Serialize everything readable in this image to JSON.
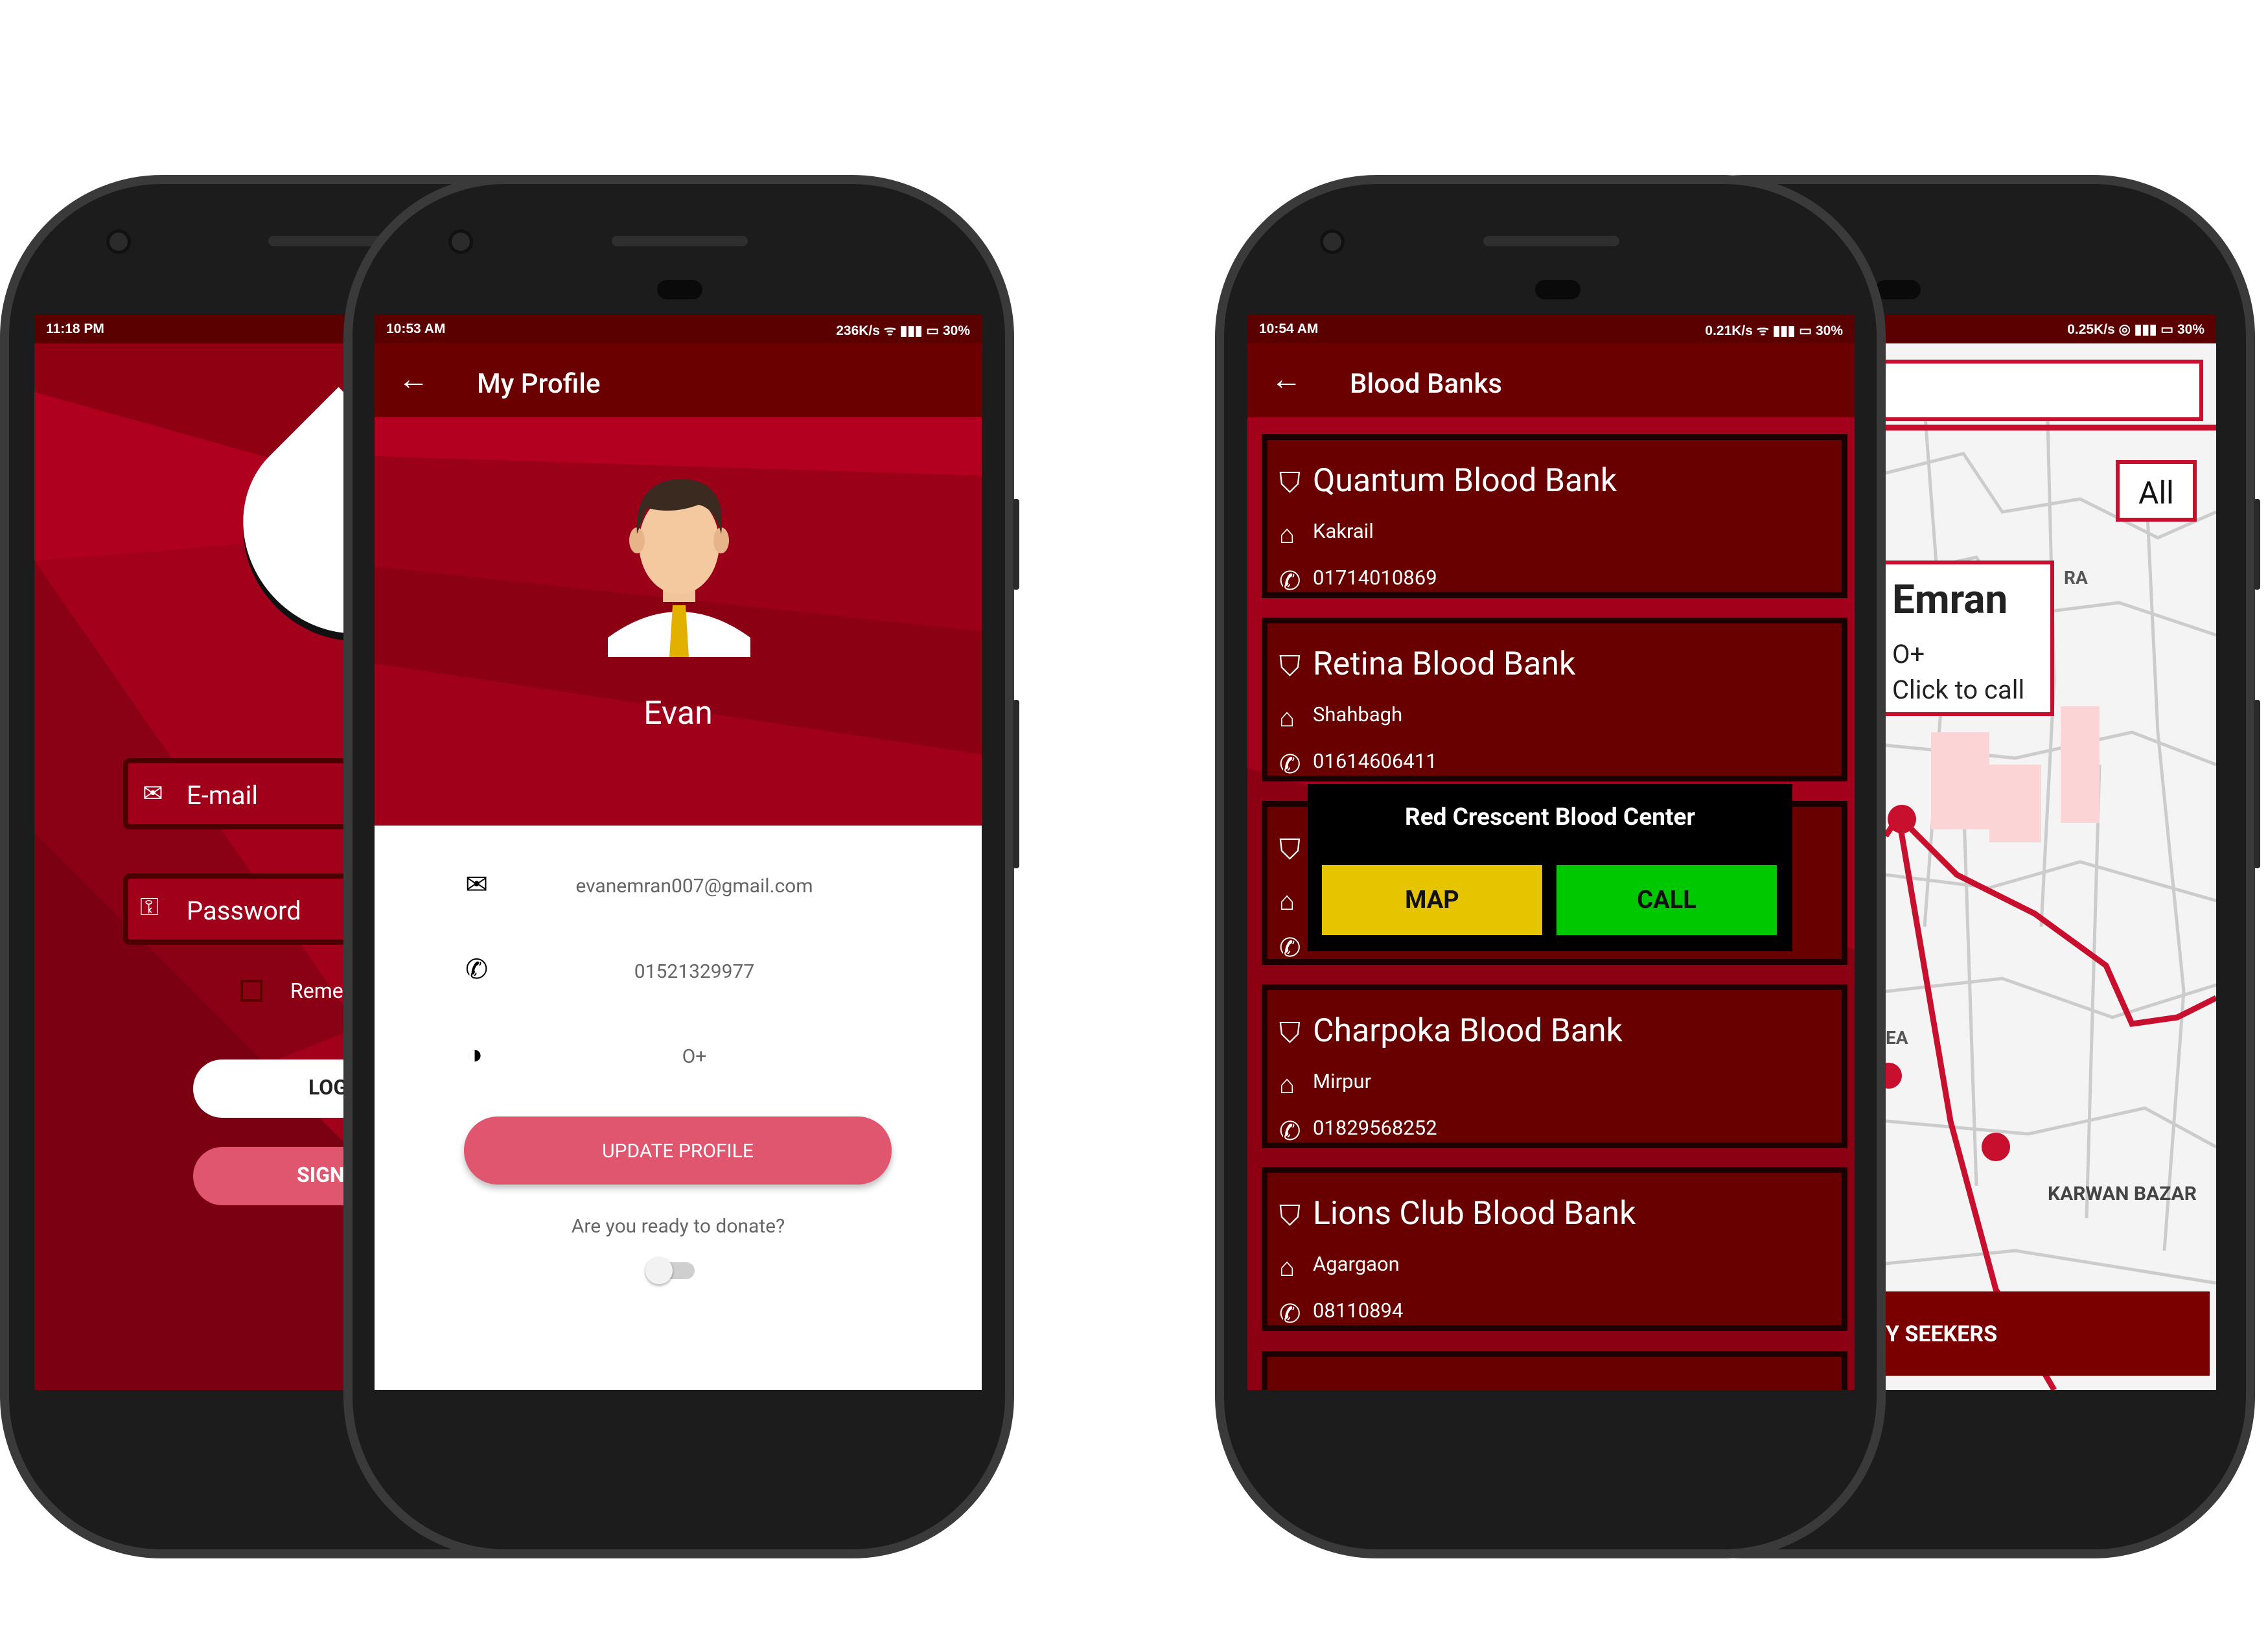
{
  "phone1": {
    "status_time": "11:18 PM",
    "email_placeholder": "E-mail",
    "password_placeholder": "Password",
    "remember_label": "Reme",
    "login_label": "LOG",
    "signup_label": "SIGN"
  },
  "phone2": {
    "status_time": "10:53 AM",
    "status_right": "236K/s ᯤ ▮▮▮ ▭ 30%",
    "title": "My Profile",
    "user_name": "Evan",
    "email": "evanemran007@gmail.com",
    "phone": "01521329977",
    "blood_group": "O+",
    "update_button": "UPDATE PROFILE",
    "donate_question": "Are you ready to donate?"
  },
  "phone3": {
    "status_time": "10:54 AM",
    "status_right": "0.21K/s ᯤ ▮▮▮ ▭ 30%",
    "title": "Blood Banks",
    "banks": [
      {
        "name": "Quantum Blood Bank",
        "area": "Kakrail",
        "phone": "01714010869"
      },
      {
        "name": "Retina Blood Bank",
        "area": "Shahbagh",
        "phone": "01614606411"
      },
      {
        "name": "",
        "area": "",
        "phone": ""
      },
      {
        "name": "Charpoka Blood Bank",
        "area": "Mirpur",
        "phone": "01829568252"
      },
      {
        "name": "Lions Club Blood Bank",
        "area": "Agargaon",
        "phone": "08110894"
      }
    ],
    "popup": {
      "title": "Red Crescent Blood Center",
      "map_label": "MAP",
      "call_label": "CALL",
      "map_color": "#e6c400",
      "call_color": "#00c800"
    }
  },
  "phone4": {
    "status_right": "0.25K/s ◎ ▮▮▮ ▭ 30%",
    "filter_label": "All",
    "info_name": "Emran",
    "info_blood": "O+",
    "info_action": "Click to call",
    "map_label_ra": "RA",
    "map_label_area": "EA",
    "map_label_karwan": "KARWAN BAZAR",
    "bottom_button": "Y SEEKERS"
  },
  "colors": {
    "primary": "#6b0000",
    "accent_red": "#a8001c",
    "button_pink": "#e0566e"
  }
}
